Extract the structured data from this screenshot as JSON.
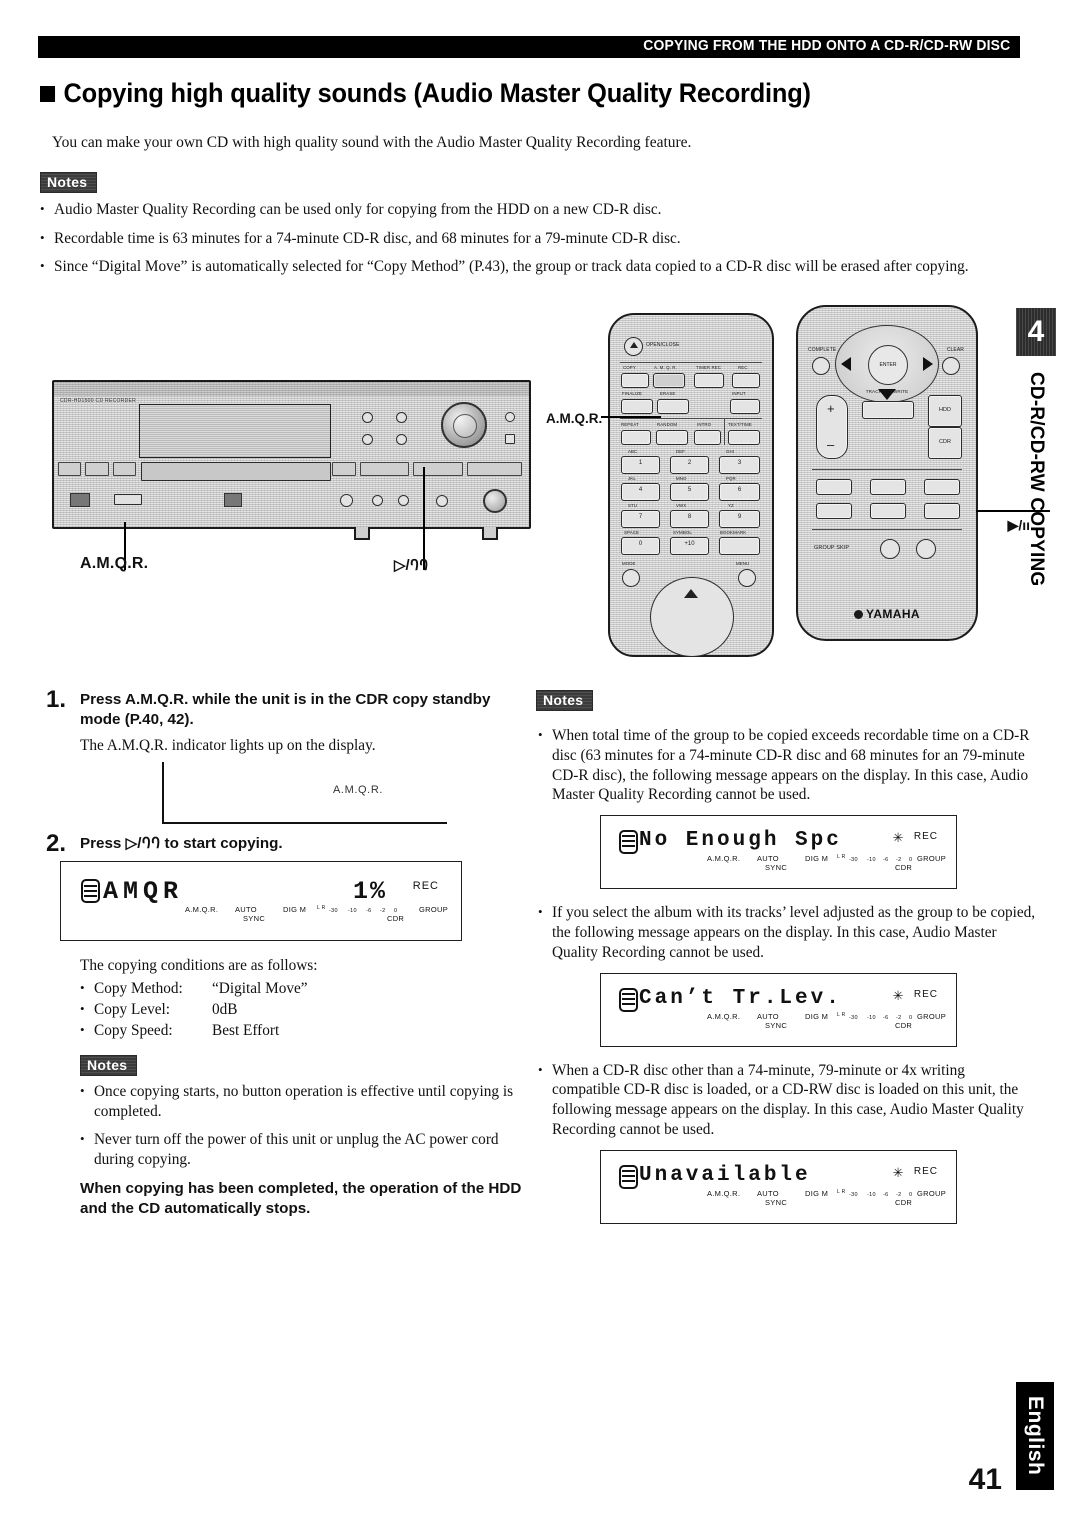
{
  "header": {
    "running_head": "COPYING FROM THE HDD ONTO A CD-R/CD-RW DISC"
  },
  "title": "Copying high quality sounds (Audio Master Quality Recording)",
  "lede": "You can make your own CD with high quality sound with the Audio Master Quality Recording feature.",
  "notes_label": "Notes",
  "top_notes": [
    "Audio Master Quality Recording can be used only for copying from the HDD on a new CD-R disc.",
    "Recordable time is 63 minutes for a 74-minute CD-R disc, and 68 minutes for a 79-minute CD-R disc.",
    "Since “Digital Move” is automatically selected for “Copy Method” (P.43), the group or track data copied to a CD-R disc will be erased after copying."
  ],
  "illustration": {
    "unit_model_text": "CDR-HD1500 CD RECORDER",
    "callout_amqr_unit": "A.M.Q.R.",
    "callout_play_unit": "▷/ꛁꛁ",
    "callout_amqr_remote": "A.M.Q.R.",
    "callout_play_remote": "▶/ıı",
    "remote_left": {
      "open_close": "OPEN/CLOSE",
      "row1": [
        "COPY",
        "A. M. Q. R.",
        "TIMER REC",
        "REC"
      ],
      "row2": [
        "FINALIZE",
        "ERASE",
        "INPUT"
      ],
      "row3": [
        "REPEAT",
        "RANDOM",
        "INTRO",
        "TEXT/TIME"
      ],
      "keypad": [
        {
          "alpha": "ABC",
          "num": "1"
        },
        {
          "alpha": "DEF",
          "num": "2"
        },
        {
          "alpha": "GHI",
          "num": "3"
        },
        {
          "alpha": "JKL",
          "num": "4"
        },
        {
          "alpha": "MNO",
          "num": "5"
        },
        {
          "alpha": "PQR",
          "num": "6"
        },
        {
          "alpha": "STU",
          "num": "7"
        },
        {
          "alpha": "VWX",
          "num": "8"
        },
        {
          "alpha": "YZ",
          "num": "9"
        },
        {
          "alpha": "SPACE",
          "num": "0"
        },
        {
          "alpha": "SYMBOL",
          "num": "+10"
        },
        {
          "alpha": "BOOKMARK",
          "num": ""
        }
      ],
      "mode": "MODE",
      "menu": "MENU"
    },
    "remote_right": {
      "enter": "ENTER",
      "complete": "COMPLETE",
      "clear": "CLEAR",
      "plus": "+",
      "minus": "–",
      "track_no_write": "TRACK NO. WRITE",
      "hdd": "HDD",
      "cdr": "CDR",
      "group_skip": "GROUP SKIP",
      "brand": "YAMAHA"
    }
  },
  "side_tab": {
    "chapter_number": "4",
    "label": "CD-R/CD-RW COPYING"
  },
  "steps": [
    {
      "number": "1.",
      "heading": "Press A.M.Q.R. while the unit is in the CDR copy standby mode (P.40, 42).",
      "body": "The A.M.Q.R. indicator lights up on the display.",
      "indicator_label": "A.M.Q.R."
    },
    {
      "number": "2.",
      "heading": "Press ▷/ꛁꛁ to start copying."
    }
  ],
  "display_amqr": {
    "disc_icon": "disc-icon",
    "main_text": "AMQR",
    "percent": "1%",
    "rec": "REC",
    "indicators": {
      "amqr": "A.M.Q.R.",
      "auto": "AUTO",
      "sync": "SYNC",
      "digm": "DIG M",
      "lr": "L R",
      "scale": [
        "-30",
        "-10",
        "-6",
        "-2",
        "0"
      ],
      "cdr": "CDR",
      "group": "GROUP"
    }
  },
  "copy_conditions": {
    "intro": "The copying conditions are as follows:",
    "rows": [
      {
        "key": "Copy Method:",
        "value": "“Digital Move”"
      },
      {
        "key": "Copy Level:",
        "value": "0dB"
      },
      {
        "key": "Copy Speed:",
        "value": "Best Effort"
      }
    ]
  },
  "left_notes": [
    "Once copying starts, no button operation is effective until copying is completed.",
    "Never turn off the power of this unit or unplug the AC power cord during copying."
  ],
  "left_bold_para": "When copying has been completed, the operation of the HDD and the CD automatically stops.",
  "right_notes": [
    "When total time of the group to be copied exceeds recordable time on a CD-R disc (63 minutes for a 74-minute CD-R disc and 68 minutes for an 79-minute CD-R disc), the following message appears on the display. In this case, Audio Master Quality Recording cannot be used.",
    "If you select the album with its tracks’ level adjusted as the group to be copied, the following message appears on the display. In this case, Audio Master Quality Recording cannot be used.",
    "When a CD-R disc other than a 74-minute, 79-minute or 4x writing compatible CD-R disc is loaded, or a CD-RW disc is loaded on this unit, the following message appears on the display. In this case, Audio Master Quality Recording cannot be used."
  ],
  "display_messages": [
    {
      "main_text": "No Enough Spc",
      "rec": "REC",
      "blink": "✳"
    },
    {
      "main_text": "Can’t Tr.Lev.",
      "rec": "REC",
      "blink": "✳"
    },
    {
      "main_text": "Unavailable",
      "rec": "REC",
      "blink": "✳"
    }
  ],
  "footer": {
    "language": "English",
    "page_number": "41"
  }
}
